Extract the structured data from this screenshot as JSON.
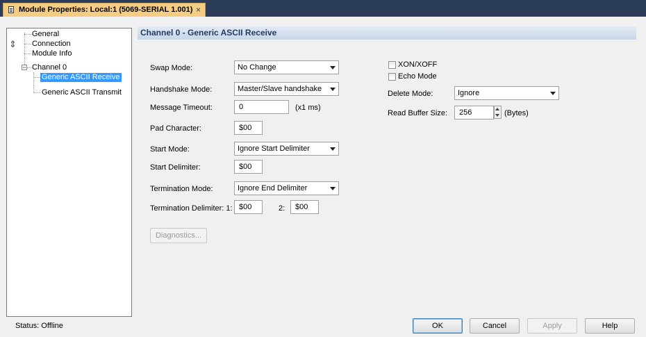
{
  "window": {
    "tab_title": "Module Properties: Local:1 (5069-SERIAL 1.001)",
    "tab_close_glyph": "×"
  },
  "tree": {
    "items": [
      {
        "label": "General"
      },
      {
        "label": "Connection"
      },
      {
        "label": "Module Info"
      },
      {
        "label": "Channel 0"
      },
      {
        "label": "Generic ASCII Receive"
      },
      {
        "label": "Generic ASCII Transmit"
      }
    ],
    "expander_glyph": "−",
    "scroll_glyph": "⇕"
  },
  "header": {
    "title": "Channel 0 - Generic ASCII Receive"
  },
  "form": {
    "swap_mode": {
      "label": "Swap Mode:",
      "value": "No Change"
    },
    "handshake_mode": {
      "label": "Handshake Mode:",
      "value": "Master/Slave handshake"
    },
    "message_timeout": {
      "label": "Message Timeout:",
      "value": "0",
      "unit": "(x1 ms)"
    },
    "pad_character": {
      "label": "Pad Character:",
      "value": "$00"
    },
    "start_mode": {
      "label": "Start Mode:",
      "value": "Ignore Start Delimiter"
    },
    "start_delimiter": {
      "label": "Start Delimiter:",
      "value": "$00"
    },
    "termination_mode": {
      "label": "Termination Mode:",
      "value": "Ignore End Delimiter"
    },
    "termination_delimiter": {
      "label": "Termination Delimiter: 1:",
      "value1": "$00",
      "label2": "2:",
      "value2": "$00"
    },
    "diagnostics_button": "Diagnostics...",
    "xon_xoff": {
      "label": "XON/XOFF",
      "checked": false
    },
    "echo_mode": {
      "label": "Echo Mode",
      "checked": false
    },
    "delete_mode": {
      "label": "Delete Mode:",
      "value": "Ignore"
    },
    "read_buffer_size": {
      "label": "Read Buffer Size:",
      "value": "256",
      "unit": "(Bytes)"
    }
  },
  "footer": {
    "status": "Status:  Offline",
    "ok": "OK",
    "cancel": "Cancel",
    "apply": "Apply",
    "help": "Help"
  }
}
